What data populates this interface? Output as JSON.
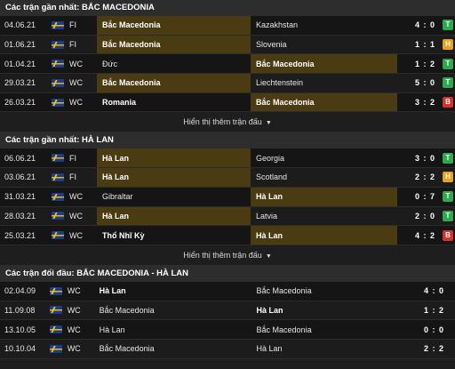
{
  "sections": [
    {
      "title": "Các trận gần nhất: BẮC MACEDONIA",
      "matches": [
        {
          "date": "04.06.21",
          "comp": "FI",
          "home": "Bắc Macedonia",
          "away": "Kazakhstan",
          "score": "4 : 0",
          "result": "T",
          "hl": "home"
        },
        {
          "date": "01.06.21",
          "comp": "FI",
          "home": "Bắc Macedonia",
          "away": "Slovenia",
          "score": "1 : 1",
          "result": "H",
          "hl": "home"
        },
        {
          "date": "01.04.21",
          "comp": "WC",
          "home": "Đức",
          "away": "Bắc Macedonia",
          "score": "1 : 2",
          "result": "T",
          "hl": "away"
        },
        {
          "date": "29.03.21",
          "comp": "WC",
          "home": "Bắc Macedonia",
          "away": "Liechtenstein",
          "score": "5 : 0",
          "result": "T",
          "hl": "home"
        },
        {
          "date": "26.03.21",
          "comp": "WC",
          "home": "Romania",
          "away": "Bắc Macedonia",
          "score": "3 : 2",
          "result": "B",
          "hl": "away"
        }
      ],
      "more_label": "Hiển thị thêm trận đấu"
    },
    {
      "title": "Các trận gần nhất: HÀ LAN",
      "matches": [
        {
          "date": "06.06.21",
          "comp": "FI",
          "home": "Hà Lan",
          "away": "Georgia",
          "score": "3 : 0",
          "result": "T",
          "hl": "home"
        },
        {
          "date": "03.06.21",
          "comp": "FI",
          "home": "Hà Lan",
          "away": "Scotland",
          "score": "2 : 2",
          "result": "H",
          "hl": "home"
        },
        {
          "date": "31.03.21",
          "comp": "WC",
          "home": "Gibraltar",
          "away": "Hà Lan",
          "score": "0 : 7",
          "result": "T",
          "hl": "away"
        },
        {
          "date": "28.03.21",
          "comp": "WC",
          "home": "Hà Lan",
          "away": "Latvia",
          "score": "2 : 0",
          "result": "T",
          "hl": "home"
        },
        {
          "date": "25.03.21",
          "comp": "WC",
          "home": "Thổ Nhĩ Kỳ",
          "away": "Hà Lan",
          "score": "4 : 2",
          "result": "B",
          "hl": "away"
        }
      ],
      "more_label": "Hiển thị thêm trận đấu"
    }
  ],
  "h2h": {
    "title": "Các trận đối đầu: BẮC MACEDONIA - HÀ LAN",
    "matches": [
      {
        "date": "02.04.09",
        "comp": "WC",
        "home": "Hà Lan",
        "away": "Bắc Macedonia",
        "score": "4 : 0",
        "winner": "home"
      },
      {
        "date": "11.09.08",
        "comp": "WC",
        "home": "Bắc Macedonia",
        "away": "Hà Lan",
        "score": "1 : 2",
        "winner": "away"
      },
      {
        "date": "13.10.05",
        "comp": "WC",
        "home": "Hà Lan",
        "away": "Bắc Macedonia",
        "score": "0 : 0",
        "winner": "none"
      },
      {
        "date": "10.10.04",
        "comp": "WC",
        "home": "Bắc Macedonia",
        "away": "Hà Lan",
        "score": "2 : 2",
        "winner": "none"
      }
    ]
  },
  "icons": {
    "competition_flag": "trophy-flag-icon",
    "more_chevron": "chevron-down-icon"
  },
  "colors": {
    "highlight": "#4a3b12",
    "win": "#2fa84f",
    "draw": "#e8a21c",
    "loss": "#d9302e"
  }
}
